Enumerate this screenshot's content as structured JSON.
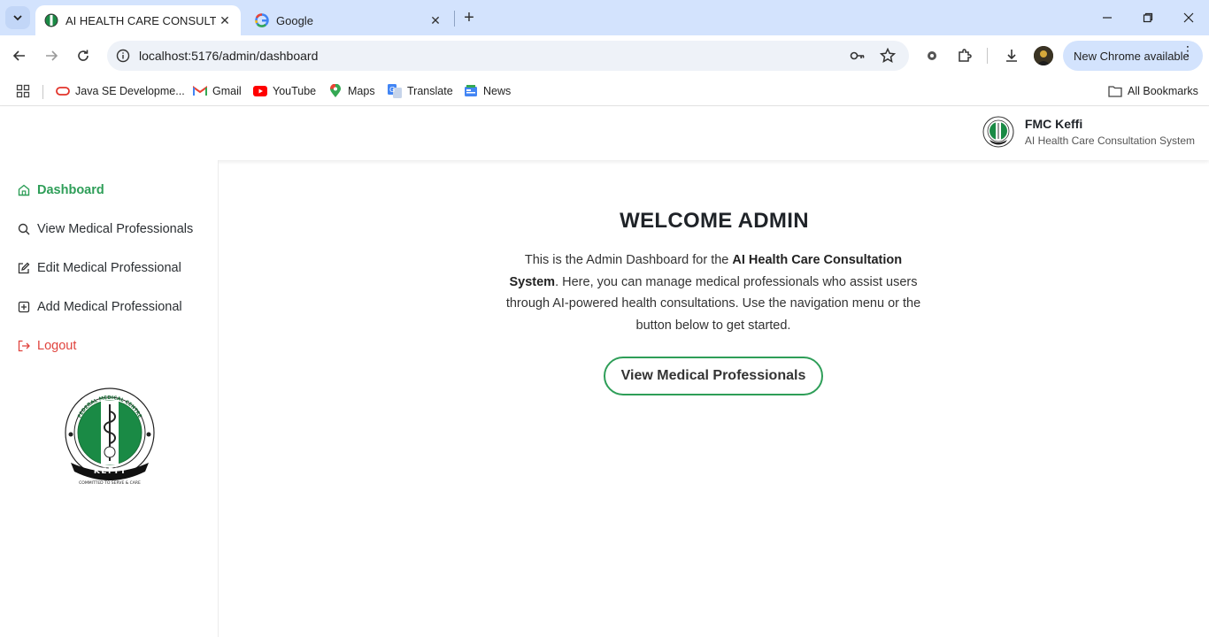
{
  "browser": {
    "tabs": [
      {
        "title": "AI HEALTH CARE CONSULTATIO",
        "active": true
      },
      {
        "title": "Google",
        "active": false
      }
    ],
    "url": "localhost:5176/admin/dashboard",
    "new_chrome_label": "New Chrome available",
    "bookmarks": [
      {
        "label": "Java SE Developme...",
        "icon": "oracle-icon"
      },
      {
        "label": "Gmail",
        "icon": "gmail-icon"
      },
      {
        "label": "YouTube",
        "icon": "youtube-icon"
      },
      {
        "label": "Maps",
        "icon": "maps-icon"
      },
      {
        "label": "Translate",
        "icon": "translate-icon"
      },
      {
        "label": "News",
        "icon": "news-icon"
      }
    ],
    "all_bookmarks_label": "All Bookmarks"
  },
  "header": {
    "org_name": "FMC Keffi",
    "system_name": "AI Health Care Consultation System"
  },
  "sidebar": {
    "items": [
      {
        "label": "Dashboard",
        "icon": "home-icon",
        "active": true
      },
      {
        "label": "View Medical Professionals",
        "icon": "search-icon"
      },
      {
        "label": "Edit Medical Professional",
        "icon": "edit-icon"
      },
      {
        "label": "Add Medical Professional",
        "icon": "plus-square-icon"
      },
      {
        "label": "Logout",
        "icon": "logout-icon"
      }
    ],
    "logo_text": [
      "FEDERAL MEDICAL CENTRE",
      "KEFFI",
      "COMMITTED TO SERVE & CARE"
    ]
  },
  "main": {
    "title": "WELCOME ADMIN",
    "intro_1": "This is the Admin Dashboard for the ",
    "intro_bold": "AI Health Care Consultation System",
    "intro_2": ". Here, you can manage medical professionals who assist users through AI-powered health consultations. Use the navigation menu or the button below to get started.",
    "cta_label": "View Medical Professionals"
  },
  "colors": {
    "accent": "#2e9e58",
    "logout": "#e0443e",
    "tabstrip": "#d3e3fd"
  }
}
